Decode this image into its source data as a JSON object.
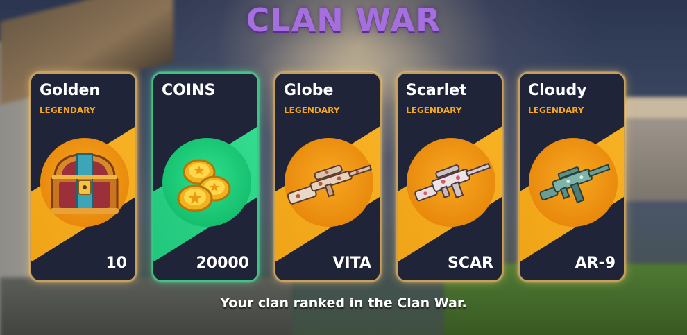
{
  "title": "CLAN WAR",
  "rewards": [
    {
      "name": "Golden",
      "rarity": "LEGENDARY",
      "amount": "10",
      "icon": "treasure-chest-icon"
    },
    {
      "name": "COINS",
      "rarity": "",
      "amount": "20000",
      "icon": "coins-icon"
    },
    {
      "name": "Globe",
      "rarity": "LEGENDARY",
      "amount": "VITA",
      "icon": "sniper-rifle-icon"
    },
    {
      "name": "Scarlet",
      "rarity": "LEGENDARY",
      "amount": "SCAR",
      "icon": "assault-rifle-icon"
    },
    {
      "name": "Cloudy",
      "rarity": "LEGENDARY",
      "amount": "AR-9",
      "icon": "smg-icon"
    }
  ],
  "footer_text": "Your clan ranked in the Clan War.",
  "colors": {
    "title": "#a66fe0",
    "rarity": "#f5a623",
    "legendary_band": "#f0a418",
    "coins_band": "#21c77c",
    "card_bg": "#1f2438"
  }
}
